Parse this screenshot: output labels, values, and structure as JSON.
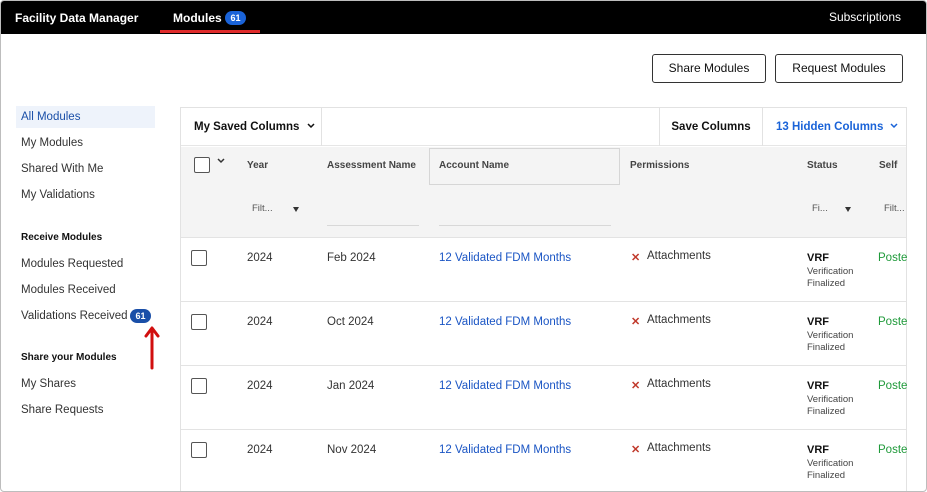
{
  "topbar": {
    "brand": "Facility Data Manager",
    "modules_label": "Modules",
    "modules_count": "61",
    "subscriptions": "Subscriptions"
  },
  "actions": {
    "share_modules": "Share Modules",
    "request_modules": "Request Modules"
  },
  "sidebar": {
    "items": [
      {
        "label": "All Modules"
      },
      {
        "label": "My Modules"
      },
      {
        "label": "Shared With Me"
      },
      {
        "label": "My Validations"
      }
    ],
    "receive_heading": "Receive Modules",
    "receive_items": [
      {
        "label": "Modules Requested"
      },
      {
        "label": "Modules Received"
      },
      {
        "label": "Validations Received"
      }
    ],
    "validations_badge": "61",
    "share_heading": "Share your Modules",
    "share_items": [
      {
        "label": "My Shares"
      },
      {
        "label": "Share Requests"
      }
    ]
  },
  "toolbar": {
    "saved_columns": "My Saved Columns",
    "save_columns": "Save Columns",
    "hidden_columns": "13 Hidden Columns"
  },
  "table": {
    "headers": {
      "year": "Year",
      "assessment": "Assessment Name",
      "account": "Account Name",
      "permissions": "Permissions",
      "status": "Status",
      "self": "Self"
    },
    "filters": {
      "year": "Filt...",
      "status": "Fi...",
      "self": "Filt..."
    },
    "rows": [
      {
        "year": "2024",
        "assessment": "Feb 2024",
        "account": "12 Validated FDM Months",
        "permission": "Attachments",
        "status": "VRF",
        "status_sub": "Verification Finalized",
        "self": "Poste"
      },
      {
        "year": "2024",
        "assessment": "Oct 2024",
        "account": "12 Validated FDM Months",
        "permission": "Attachments",
        "status": "VRF",
        "status_sub": "Verification Finalized",
        "self": "Poste"
      },
      {
        "year": "2024",
        "assessment": "Jan 2024",
        "account": "12 Validated FDM Months",
        "permission": "Attachments",
        "status": "VRF",
        "status_sub": "Verification Finalized",
        "self": "Poste"
      },
      {
        "year": "2024",
        "assessment": "Nov 2024",
        "account": "12 Validated FDM Months",
        "permission": "Attachments",
        "status": "VRF",
        "status_sub": "Verification Finalized",
        "self": "Poste"
      }
    ]
  },
  "colors": {
    "accent": "#1a63d8",
    "nav_underline": "#e02b2b",
    "annotation_arrow": "#d10f0f",
    "posted": "#1f9a3a"
  }
}
